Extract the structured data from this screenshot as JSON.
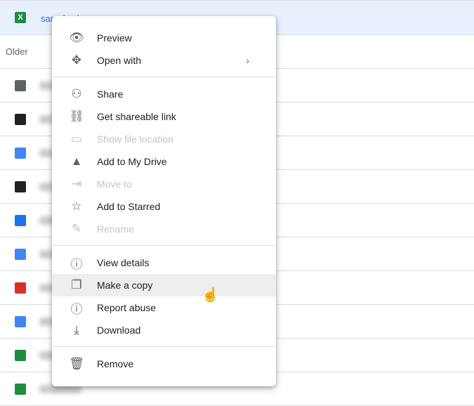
{
  "top_file": {
    "name": "sample.xlsx",
    "icon": "excel-icon",
    "color": "#1e8e3e"
  },
  "section_header": "Older",
  "rows": [
    {
      "icon": "shared-folder-icon",
      "color": "#5f6368"
    },
    {
      "icon": "list-icon",
      "color": "#202124"
    },
    {
      "icon": "docs-icon",
      "color": "#4285f4"
    },
    {
      "icon": "list-icon",
      "color": "#202124"
    },
    {
      "icon": "doc-file-icon",
      "color": "#1a73e8"
    },
    {
      "icon": "docs-icon",
      "color": "#4285f4"
    },
    {
      "icon": "audio-icon",
      "color": "#d93025"
    },
    {
      "icon": "docs-icon",
      "color": "#4285f4"
    },
    {
      "icon": "sheets-icon",
      "color": "#1e8e3e"
    },
    {
      "icon": "sheets-icon",
      "color": "#1e8e3e"
    }
  ],
  "menu": {
    "groups": [
      [
        {
          "label": "Preview",
          "icon": "eye-icon",
          "glyph": "👁"
        },
        {
          "label": "Open with",
          "icon": "move-arrows-icon",
          "glyph": "✥",
          "submenu": true
        }
      ],
      [
        {
          "label": "Share",
          "icon": "add-person-icon",
          "glyph": "⚇"
        },
        {
          "label": "Get shareable link",
          "icon": "link-icon",
          "glyph": "⛓"
        },
        {
          "label": "Show file location",
          "icon": "folder-icon",
          "glyph": "▭",
          "disabled": true
        },
        {
          "label": "Add to My Drive",
          "icon": "drive-add-icon",
          "glyph": "▲"
        },
        {
          "label": "Move to",
          "icon": "move-folder-icon",
          "glyph": "⇥",
          "disabled": true
        },
        {
          "label": "Add to Starred",
          "icon": "star-icon",
          "glyph": "☆"
        },
        {
          "label": "Rename",
          "icon": "pencil-icon",
          "glyph": "✎",
          "disabled": true
        }
      ],
      [
        {
          "label": "View details",
          "icon": "info-icon",
          "glyph": "ⓘ"
        },
        {
          "label": "Make a copy",
          "icon": "copy-icon",
          "glyph": "❐",
          "hover": true
        },
        {
          "label": "Report abuse",
          "icon": "report-icon",
          "glyph": "ⓘ"
        },
        {
          "label": "Download",
          "icon": "download-icon",
          "glyph": "⤓"
        }
      ],
      [
        {
          "label": "Remove",
          "icon": "trash-icon",
          "glyph": "🗑"
        }
      ]
    ]
  }
}
